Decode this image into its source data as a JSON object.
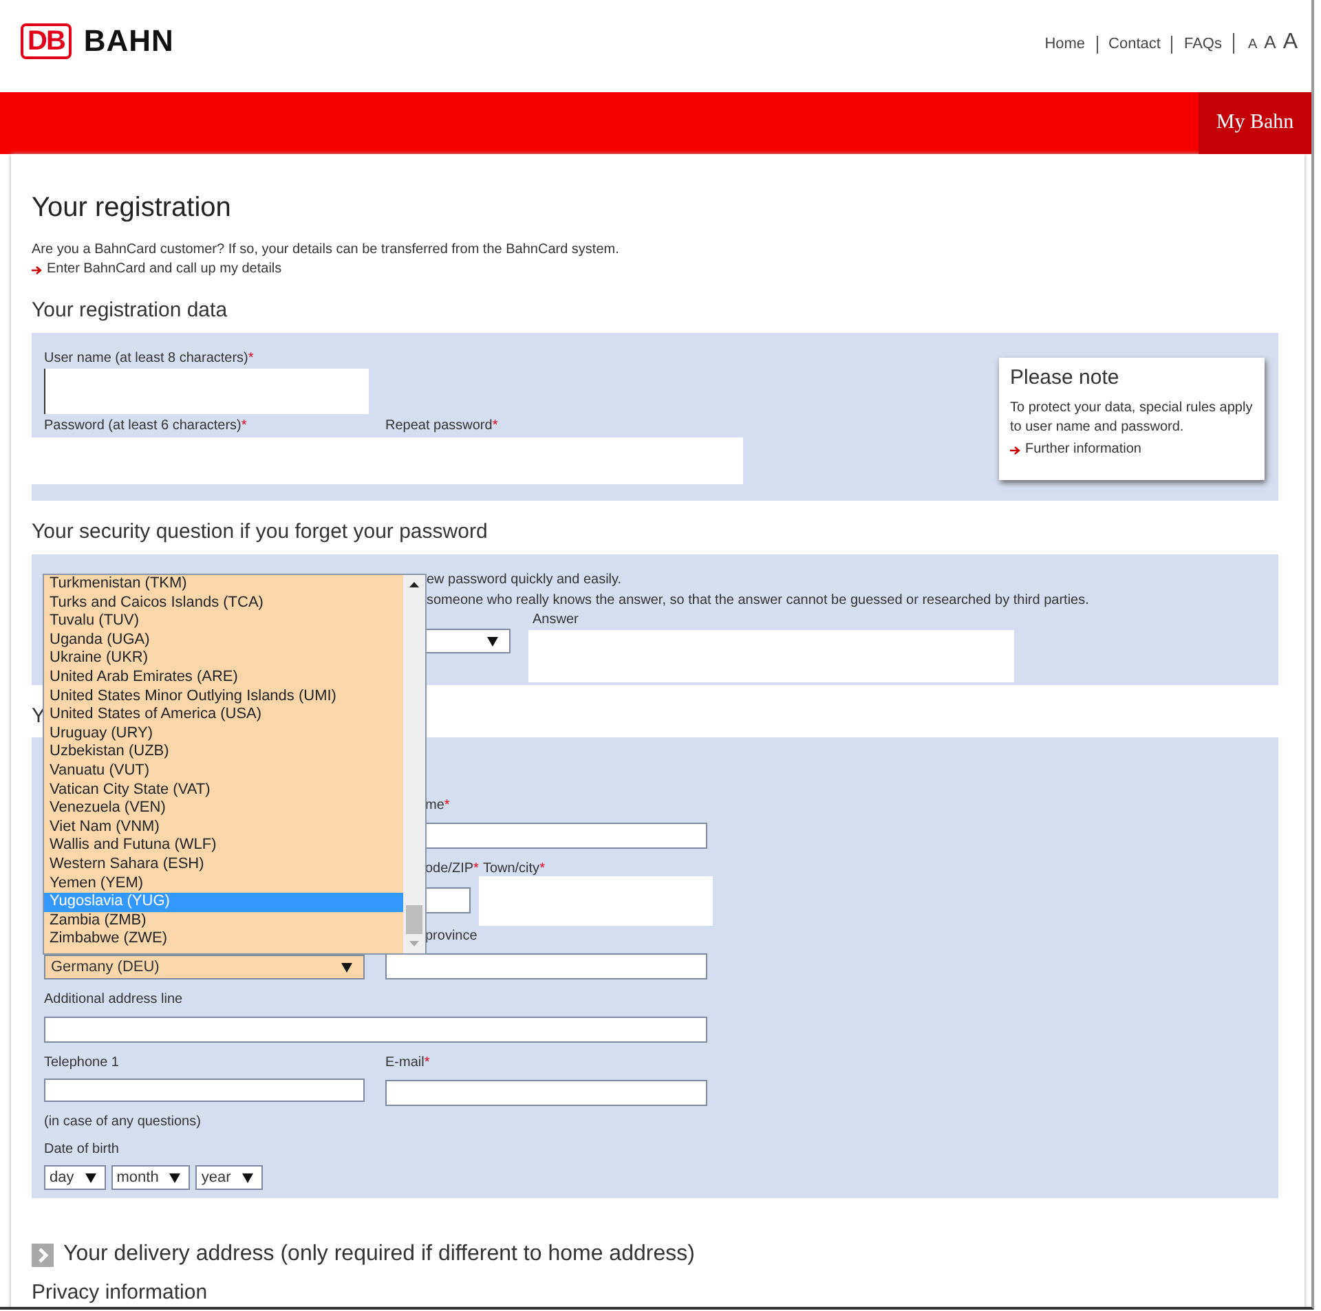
{
  "header": {
    "logo": {
      "mark": "DB",
      "wordmark": "BAHN"
    },
    "nav": [
      "Home",
      "Contact",
      "FAQs"
    ],
    "text_sizes": [
      "A",
      "A",
      "A"
    ]
  },
  "banner": {
    "label": "My Bahn"
  },
  "registration": {
    "title": "Your registration",
    "intro": "Are you a BahnCard customer? If so, your details can be transferred from the BahnCard system.",
    "link": "Enter BahnCard and call up my details"
  },
  "registration_data": {
    "heading": "Your registration data",
    "username": {
      "label": "User name (at least 8 characters)",
      "required_mark": "*"
    },
    "password": {
      "label": "Password (at least 6 characters)",
      "required_mark": "*"
    },
    "repeat_password": {
      "label": "Repeat password",
      "required_mark": "*"
    },
    "note": {
      "title": "Please note",
      "text": "To protect your data, special rules apply to user name and password.",
      "link": "Further information"
    }
  },
  "security": {
    "heading": "Your security question if you forget your password",
    "text_lines": [
      "ew password quickly and easily.",
      "someone who really knows the answer, so that the answer cannot be guessed or researched by third parties."
    ],
    "answer_label": "Answer"
  },
  "address": {
    "heading": "Y",
    "name_field": {
      "label": "me",
      "required_mark": "*"
    },
    "postcode": {
      "label": "ode/ZIP",
      "required_mark": "*"
    },
    "town": {
      "label": "Town/city",
      "required_mark": "*"
    },
    "region": {
      "label": "province"
    },
    "country": {
      "value": "Germany (DEU)",
      "expanded": true,
      "options": [
        {
          "label": "Turkmenistan (TKM)",
          "selected": false
        },
        {
          "label": "Turks and Caicos Islands (TCA)",
          "selected": false
        },
        {
          "label": "Tuvalu (TUV)",
          "selected": false
        },
        {
          "label": "Uganda (UGA)",
          "selected": false
        },
        {
          "label": "Ukraine (UKR)",
          "selected": false
        },
        {
          "label": "United Arab Emirates (ARE)",
          "selected": false
        },
        {
          "label": "United States Minor Outlying Islands (UMI)",
          "selected": false
        },
        {
          "label": "United States of America (USA)",
          "selected": false
        },
        {
          "label": "Uruguay (URY)",
          "selected": false
        },
        {
          "label": "Uzbekistan (UZB)",
          "selected": false
        },
        {
          "label": "Vanuatu (VUT)",
          "selected": false
        },
        {
          "label": "Vatican City State (VAT)",
          "selected": false
        },
        {
          "label": "Venezuela (VEN)",
          "selected": false
        },
        {
          "label": "Viet Nam (VNM)",
          "selected": false
        },
        {
          "label": "Wallis and Futuna (WLF)",
          "selected": false
        },
        {
          "label": "Western Sahara (ESH)",
          "selected": false
        },
        {
          "label": "Yemen (YEM)",
          "selected": false
        },
        {
          "label": "Yugoslavia (YUG)",
          "selected": true
        },
        {
          "label": "Zambia (ZMB)",
          "selected": false
        },
        {
          "label": "Zimbabwe (ZWE)",
          "selected": false
        }
      ]
    },
    "additional_line": {
      "label": "Additional address line"
    },
    "telephone": {
      "label": "Telephone 1",
      "hint": "(in case of any questions)"
    },
    "email": {
      "label": "E-mail",
      "required_mark": "*"
    },
    "birth_date": {
      "label": "Date of birth",
      "selects": [
        "day",
        "month",
        "year"
      ]
    }
  },
  "delivery": {
    "heading": "Your delivery address (only required if different to home address)"
  },
  "privacy": {
    "heading": "Privacy information"
  }
}
